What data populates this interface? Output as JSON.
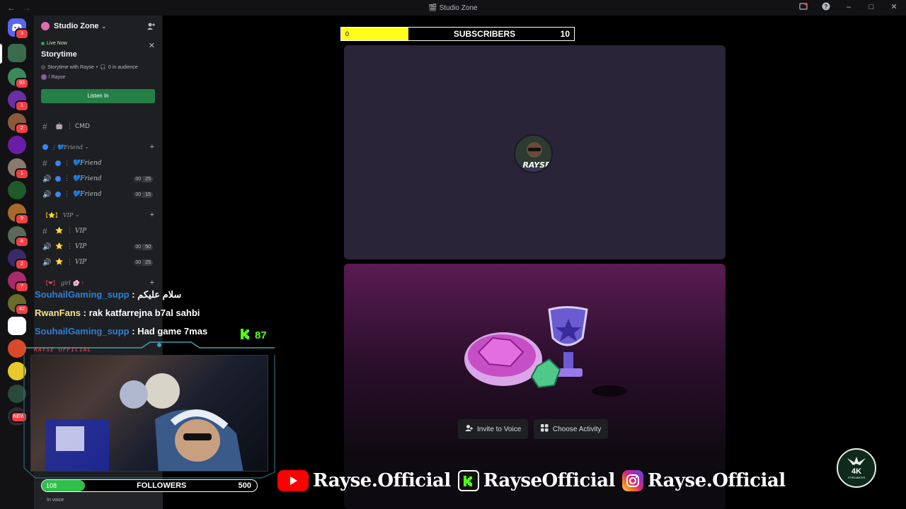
{
  "window": {
    "title": "Studio Zone"
  },
  "server_rail": {
    "badges": [
      "3",
      "93",
      "1",
      "2",
      "1",
      "9",
      "8",
      "2",
      "7",
      "42",
      "NEW"
    ]
  },
  "server": {
    "name": "Studio Zone"
  },
  "live_stage": {
    "status": "Live Now",
    "title": "Storytime",
    "meta": "Storytime with Rayse",
    "audience": "0 in audience",
    "host": "l Rayse",
    "listen_label": "Listen In"
  },
  "channels": {
    "top": [
      {
        "name": "CMD",
        "emoji": "🤖"
      }
    ],
    "categories": [
      {
        "label": "💙Friend",
        "items": [
          {
            "type": "text",
            "name": "💙Friend"
          },
          {
            "type": "voice",
            "name": "💙Friend",
            "count_a": "00",
            "count_b": "25"
          },
          {
            "type": "voice",
            "name": "💙Friend",
            "count_a": "00",
            "count_b": "15"
          }
        ]
      },
      {
        "label": "VIP",
        "items": [
          {
            "type": "text",
            "name": "VIP"
          },
          {
            "type": "voice",
            "name": "VIP",
            "count_a": "00",
            "count_b": "50"
          },
          {
            "type": "voice",
            "name": "VIP",
            "count_a": "00",
            "count_b": "25"
          }
        ]
      },
      {
        "label": "girl 🌸",
        "items": []
      }
    ]
  },
  "user_panel": {
    "status": "In voice"
  },
  "overlay": {
    "subscribers": {
      "label": "SUBSCRIBERS",
      "current": "0",
      "goal": "10",
      "progress": 0.29
    },
    "followers": {
      "label": "FOLLOWERS",
      "current": "108",
      "goal": "500",
      "progress": 0.2
    },
    "kick_viewers": "87",
    "cam_label": "RAYSE OFFICIAL",
    "chat": [
      {
        "user": "SouhailGaming_supp",
        "msg": "سلام عليكم",
        "style": "blue"
      },
      {
        "user": "RwanFans",
        "msg": "rak katfarrejna b7al sahbi",
        "style": "yellow"
      },
      {
        "user": "SouhailGaming_supp",
        "msg": "Had game 7mas",
        "style": "blue"
      }
    ],
    "socials": [
      {
        "platform": "youtube",
        "handle": "Rayse.Official",
        "color": "#ff0000"
      },
      {
        "platform": "kick",
        "handle": "RayseOfficial",
        "color": "#53fc18"
      },
      {
        "platform": "instagram",
        "handle": "Rayse.Official",
        "color": "#d62976"
      }
    ],
    "badge": {
      "main": "4K",
      "sub": "STREAMERS"
    }
  },
  "call": {
    "participant_label": "RAYSE",
    "invite_label": "Invite to Voice",
    "activity_label": "Choose Activity"
  },
  "colors": {
    "discord_green": "#248046",
    "sub_fill": "#ffff1a",
    "follow_fill": "#2fbf4a",
    "kick_green": "#53fc18"
  }
}
